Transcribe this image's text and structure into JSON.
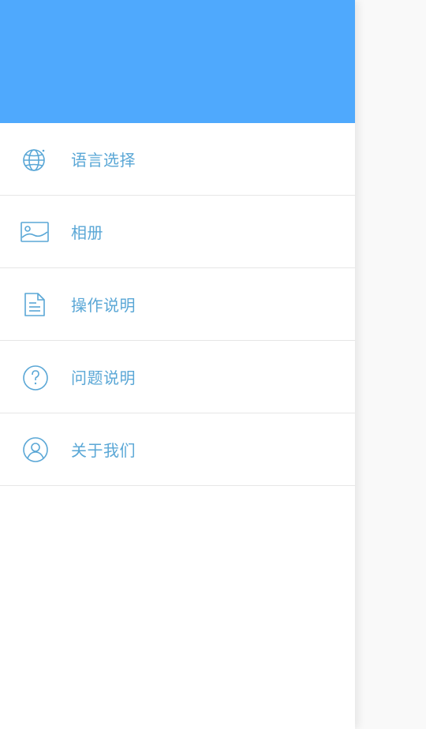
{
  "theme": {
    "header_color": "#4fa9fd",
    "accent": "#5aa7d6",
    "divider": "#e6e6e6"
  },
  "drawer": {
    "menu": [
      {
        "label": "语言选择",
        "icon": "globe-icon"
      },
      {
        "label": "相册",
        "icon": "image-icon"
      },
      {
        "label": "操作说明",
        "icon": "document-icon"
      },
      {
        "label": "问题说明",
        "icon": "question-icon"
      },
      {
        "label": "关于我们",
        "icon": "user-icon"
      }
    ]
  }
}
